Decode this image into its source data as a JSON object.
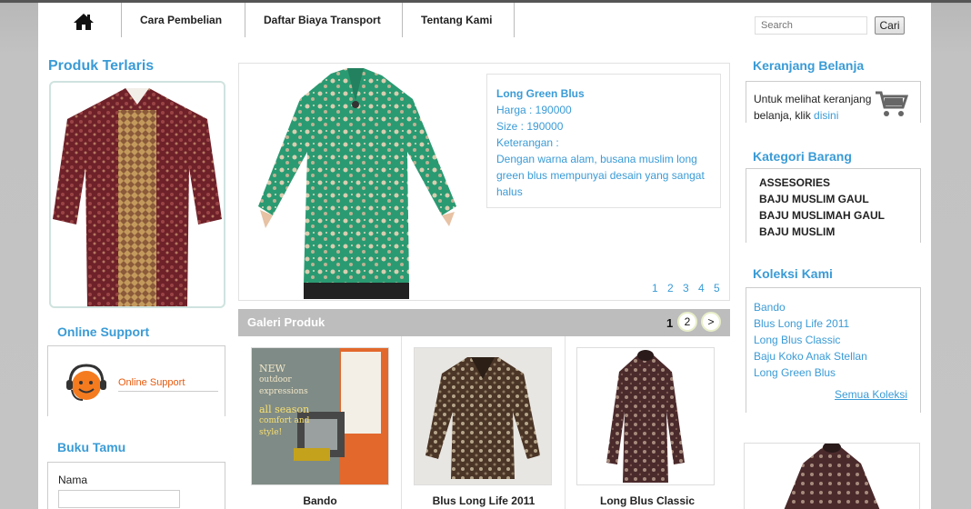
{
  "nav": {
    "items": [
      "Cara Pembelian",
      "Daftar Biaya Transport",
      "Tentang Kami"
    ]
  },
  "search": {
    "placeholder": "Search",
    "button": "Cari"
  },
  "left": {
    "bestseller_title": "Produk Terlaris",
    "support_title": "Online Support",
    "support_badge": "Online Support",
    "guestbook_title": "Buku Tamu",
    "guestbook_name_label": "Nama"
  },
  "feature": {
    "title": "Long Green Blus",
    "price": "Harga : 190000",
    "size": "Size : 190000",
    "desc_label": "Keterangan :",
    "desc": "Dengan warna alam, busana muslim long green blus mempunyai desain yang sangat halus",
    "pages": [
      "1",
      "2",
      "3",
      "4",
      "5"
    ]
  },
  "gallery": {
    "title": "Galeri Produk",
    "current_page": "1",
    "next_page": "2",
    "next": ">",
    "items": [
      {
        "caption": "Bando"
      },
      {
        "caption": "Blus Long Life 2011"
      },
      {
        "caption": "Long Blus Classic"
      }
    ],
    "bando_ad": [
      "NEW",
      "outdoor expressions",
      "all season",
      "comfort and style!"
    ]
  },
  "right": {
    "cart_title": "Keranjang Belanja",
    "cart_text": "Untuk melihat keranjang belanja, klik",
    "cart_link": "disini",
    "category_title": "Kategori Barang",
    "categories": [
      "ASSESORIES",
      "BAJU MUSLIM GAUL",
      "BAJU MUSLIMAH GAUL",
      "BAJU MUSLIM"
    ],
    "collection_title": "Koleksi Kami",
    "collections": [
      "Bando",
      "Blus Long Life 2011",
      "Long Blus Classic",
      "Baju Koko Anak Stellan",
      "Long Green Blus"
    ],
    "collection_more": "Semua Koleksi"
  },
  "colors": {
    "accent": "#3a9bd6",
    "gallery_bar": "#bdbdbd",
    "shirt_green": "#2a9a72",
    "batik_red": "#7a2a2e"
  }
}
